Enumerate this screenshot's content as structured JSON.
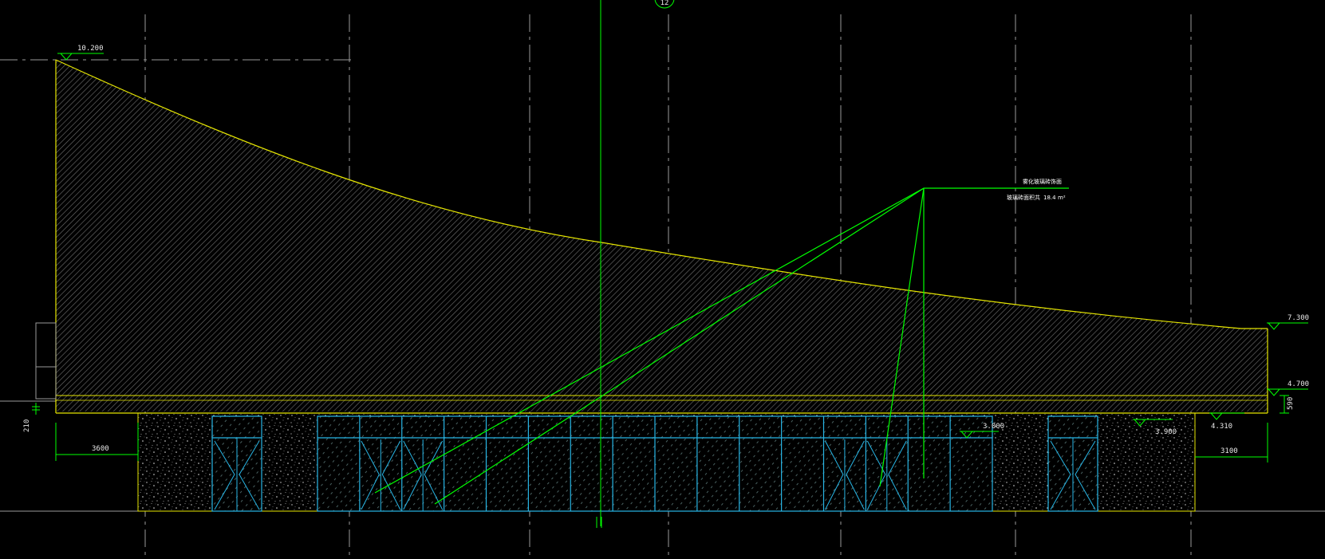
{
  "colors": {
    "background": "#000000",
    "grid_line": "#9a9a9a",
    "roof_outline": "#e6e600",
    "hatch": "#6a6a6a",
    "leader": "#00ff00",
    "window_frame": "#27b6e6",
    "text": "#e8e8e8"
  },
  "axis_bubble": {
    "label": "12"
  },
  "levels": {
    "top": "10.200",
    "right_top": "7.300",
    "right_mid": "4.700",
    "right_low": "4.310",
    "inner_a": "3.900",
    "inner_b": "3.000"
  },
  "dimensions": {
    "left_width": "3600",
    "right_width": "3100",
    "left_vertical": "210",
    "right_vertical": "590"
  },
  "annotation": {
    "line1": "雾化玻璃砖饰面",
    "line2_label": "玻璃砖面积共",
    "line2_value": "18.4",
    "line2_unit": "m²"
  }
}
